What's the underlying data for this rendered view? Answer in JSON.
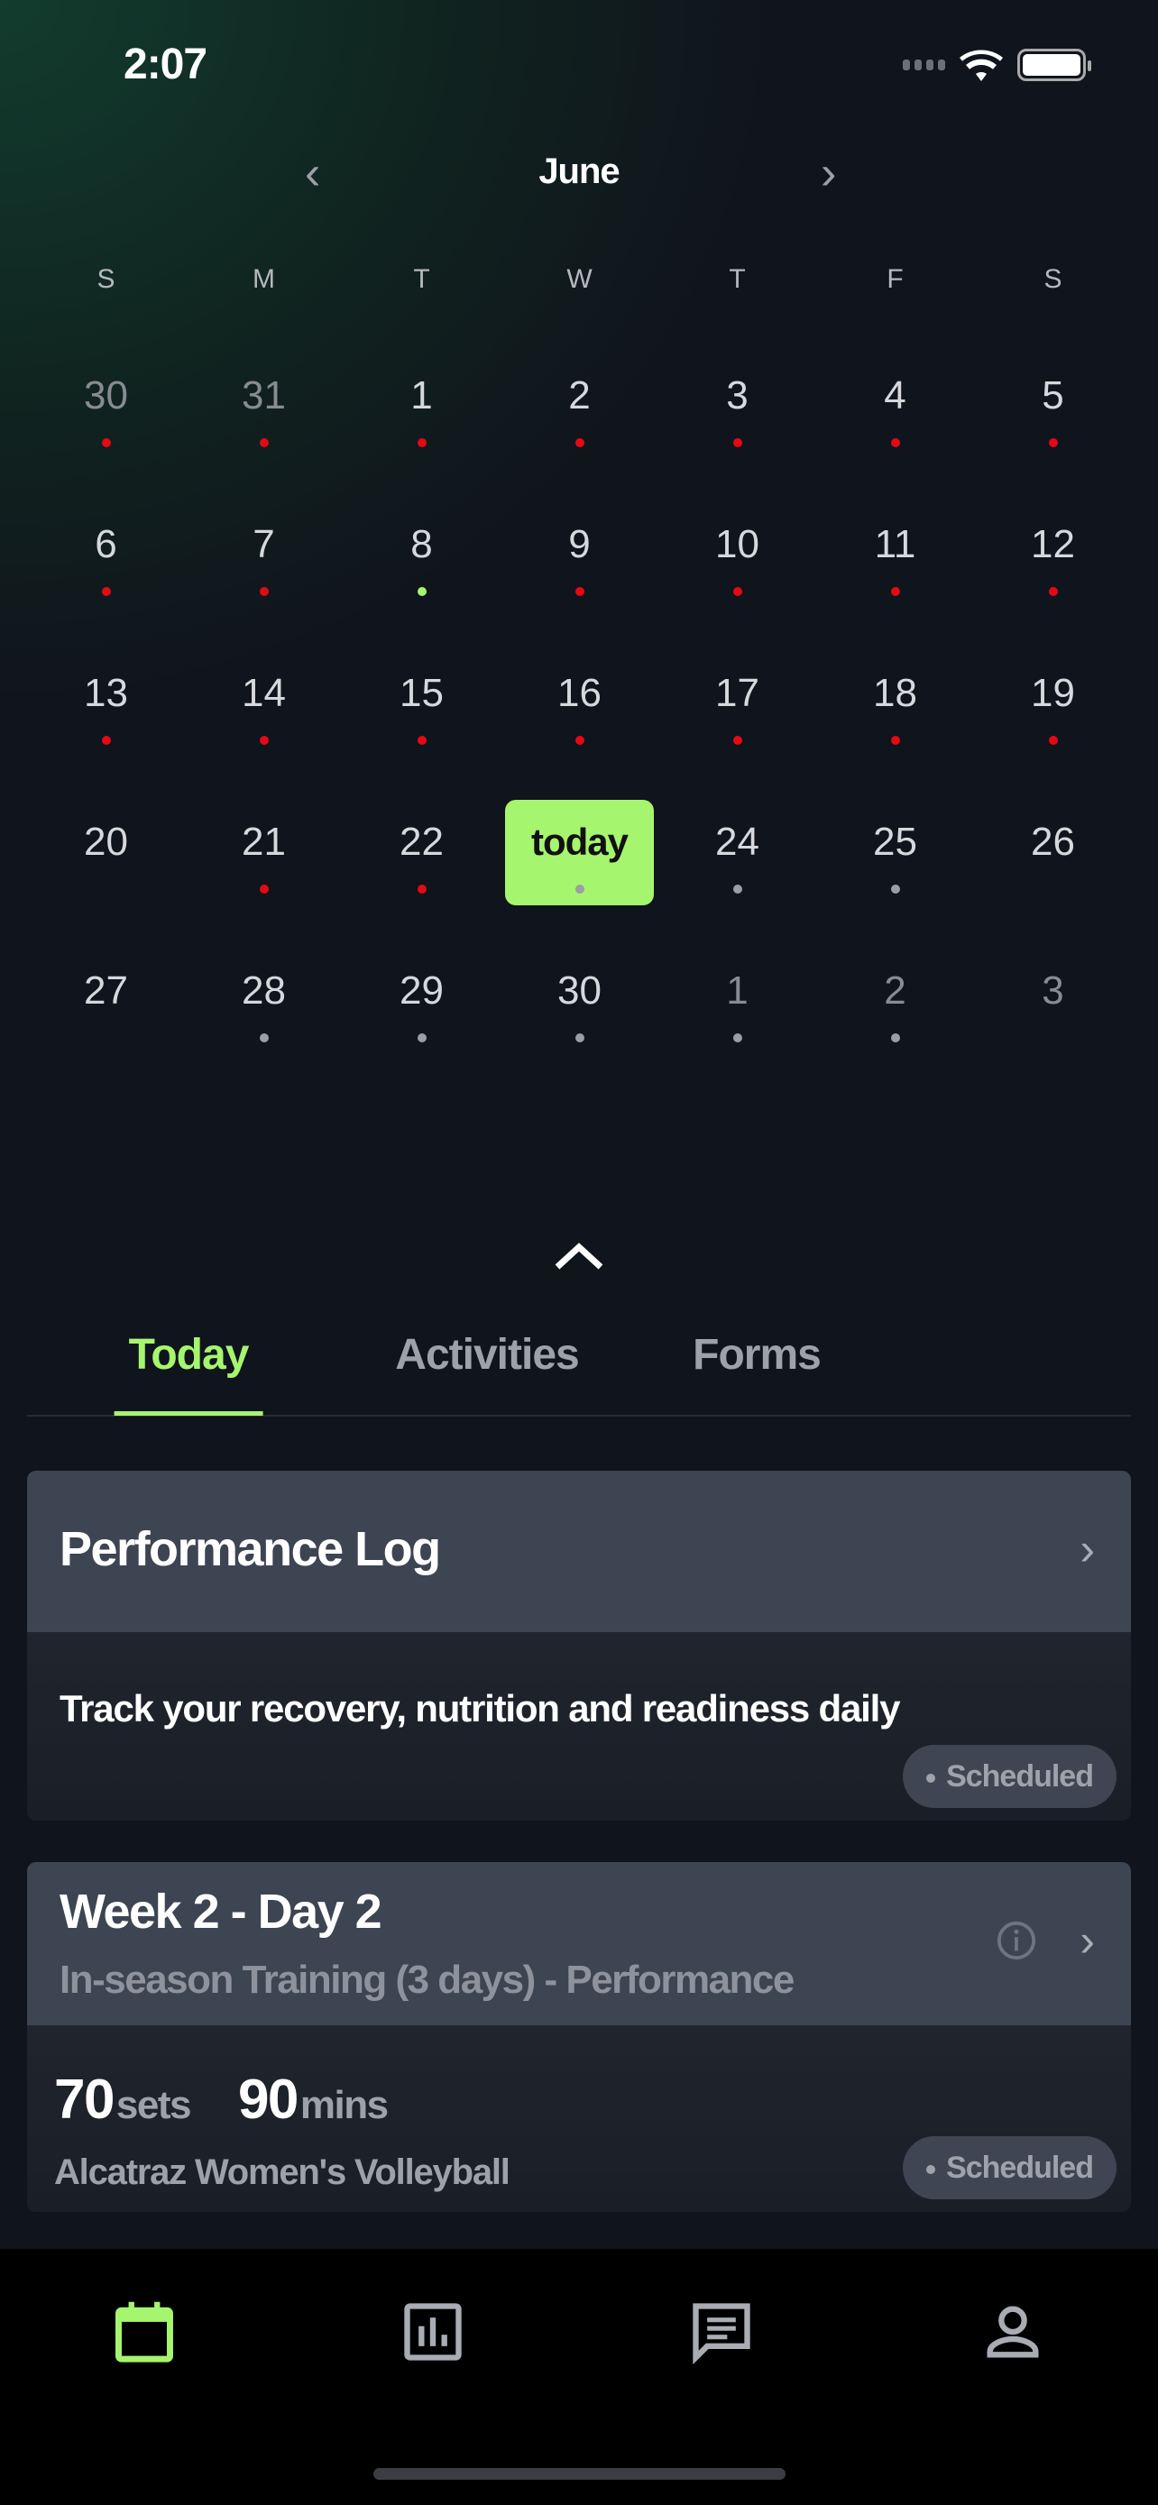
{
  "status_bar": {
    "time": "2:07"
  },
  "calendar": {
    "month": "June",
    "weekdays": [
      "S",
      "M",
      "T",
      "W",
      "T",
      "F",
      "S"
    ],
    "colors": {
      "red": "#e50914",
      "green": "#a6f56e",
      "gray": "#9a9ea5"
    },
    "weeks": [
      [
        {
          "d": "30",
          "muted": true,
          "dot": "red"
        },
        {
          "d": "31",
          "muted": true,
          "dot": "red"
        },
        {
          "d": "1",
          "dot": "red"
        },
        {
          "d": "2",
          "dot": "red"
        },
        {
          "d": "3",
          "dot": "red"
        },
        {
          "d": "4",
          "dot": "red"
        },
        {
          "d": "5",
          "dot": "red"
        }
      ],
      [
        {
          "d": "6",
          "dot": "red"
        },
        {
          "d": "7",
          "dot": "red"
        },
        {
          "d": "8",
          "dot": "green"
        },
        {
          "d": "9",
          "dot": "red"
        },
        {
          "d": "10",
          "dot": "red"
        },
        {
          "d": "11",
          "dot": "red"
        },
        {
          "d": "12",
          "dot": "red"
        }
      ],
      [
        {
          "d": "13",
          "dot": "red"
        },
        {
          "d": "14",
          "dot": "red"
        },
        {
          "d": "15",
          "dot": "red"
        },
        {
          "d": "16",
          "dot": "red"
        },
        {
          "d": "17",
          "dot": "red"
        },
        {
          "d": "18",
          "dot": "red"
        },
        {
          "d": "19",
          "dot": "red"
        }
      ],
      [
        {
          "d": "20"
        },
        {
          "d": "21",
          "dot": "red"
        },
        {
          "d": "22",
          "dot": "red"
        },
        {
          "d": "today",
          "today": true,
          "dot": "gray"
        },
        {
          "d": "24",
          "dot": "gray"
        },
        {
          "d": "25",
          "dot": "gray"
        },
        {
          "d": "26"
        }
      ],
      [
        {
          "d": "27"
        },
        {
          "d": "28",
          "dot": "gray"
        },
        {
          "d": "29",
          "dot": "gray"
        },
        {
          "d": "30",
          "dot": "gray"
        },
        {
          "d": "1",
          "muted": true,
          "dot": "gray"
        },
        {
          "d": "2",
          "muted": true,
          "dot": "gray"
        },
        {
          "d": "3",
          "muted": true
        }
      ]
    ]
  },
  "tabs": [
    {
      "label": "Today",
      "active": true
    },
    {
      "label": "Activities"
    },
    {
      "label": "Forms"
    }
  ],
  "cards": [
    {
      "title": "Performance Log",
      "description": "Track your recovery, nutrition and readiness daily",
      "status": "Scheduled"
    },
    {
      "title": "Week 2 - Day 2",
      "subtitle": "In-season Training (3 days) - Performance",
      "sets": "70",
      "sets_unit": "sets",
      "mins": "90",
      "mins_unit": "mins",
      "team": "Alcatraz Women's Volleyball",
      "status": "Scheduled"
    }
  ],
  "bottom_nav": [
    {
      "icon": "calendar-icon",
      "active": true
    },
    {
      "icon": "bar-chart-icon"
    },
    {
      "icon": "chat-icon"
    },
    {
      "icon": "profile-icon"
    }
  ],
  "accent": "#a6f56e"
}
